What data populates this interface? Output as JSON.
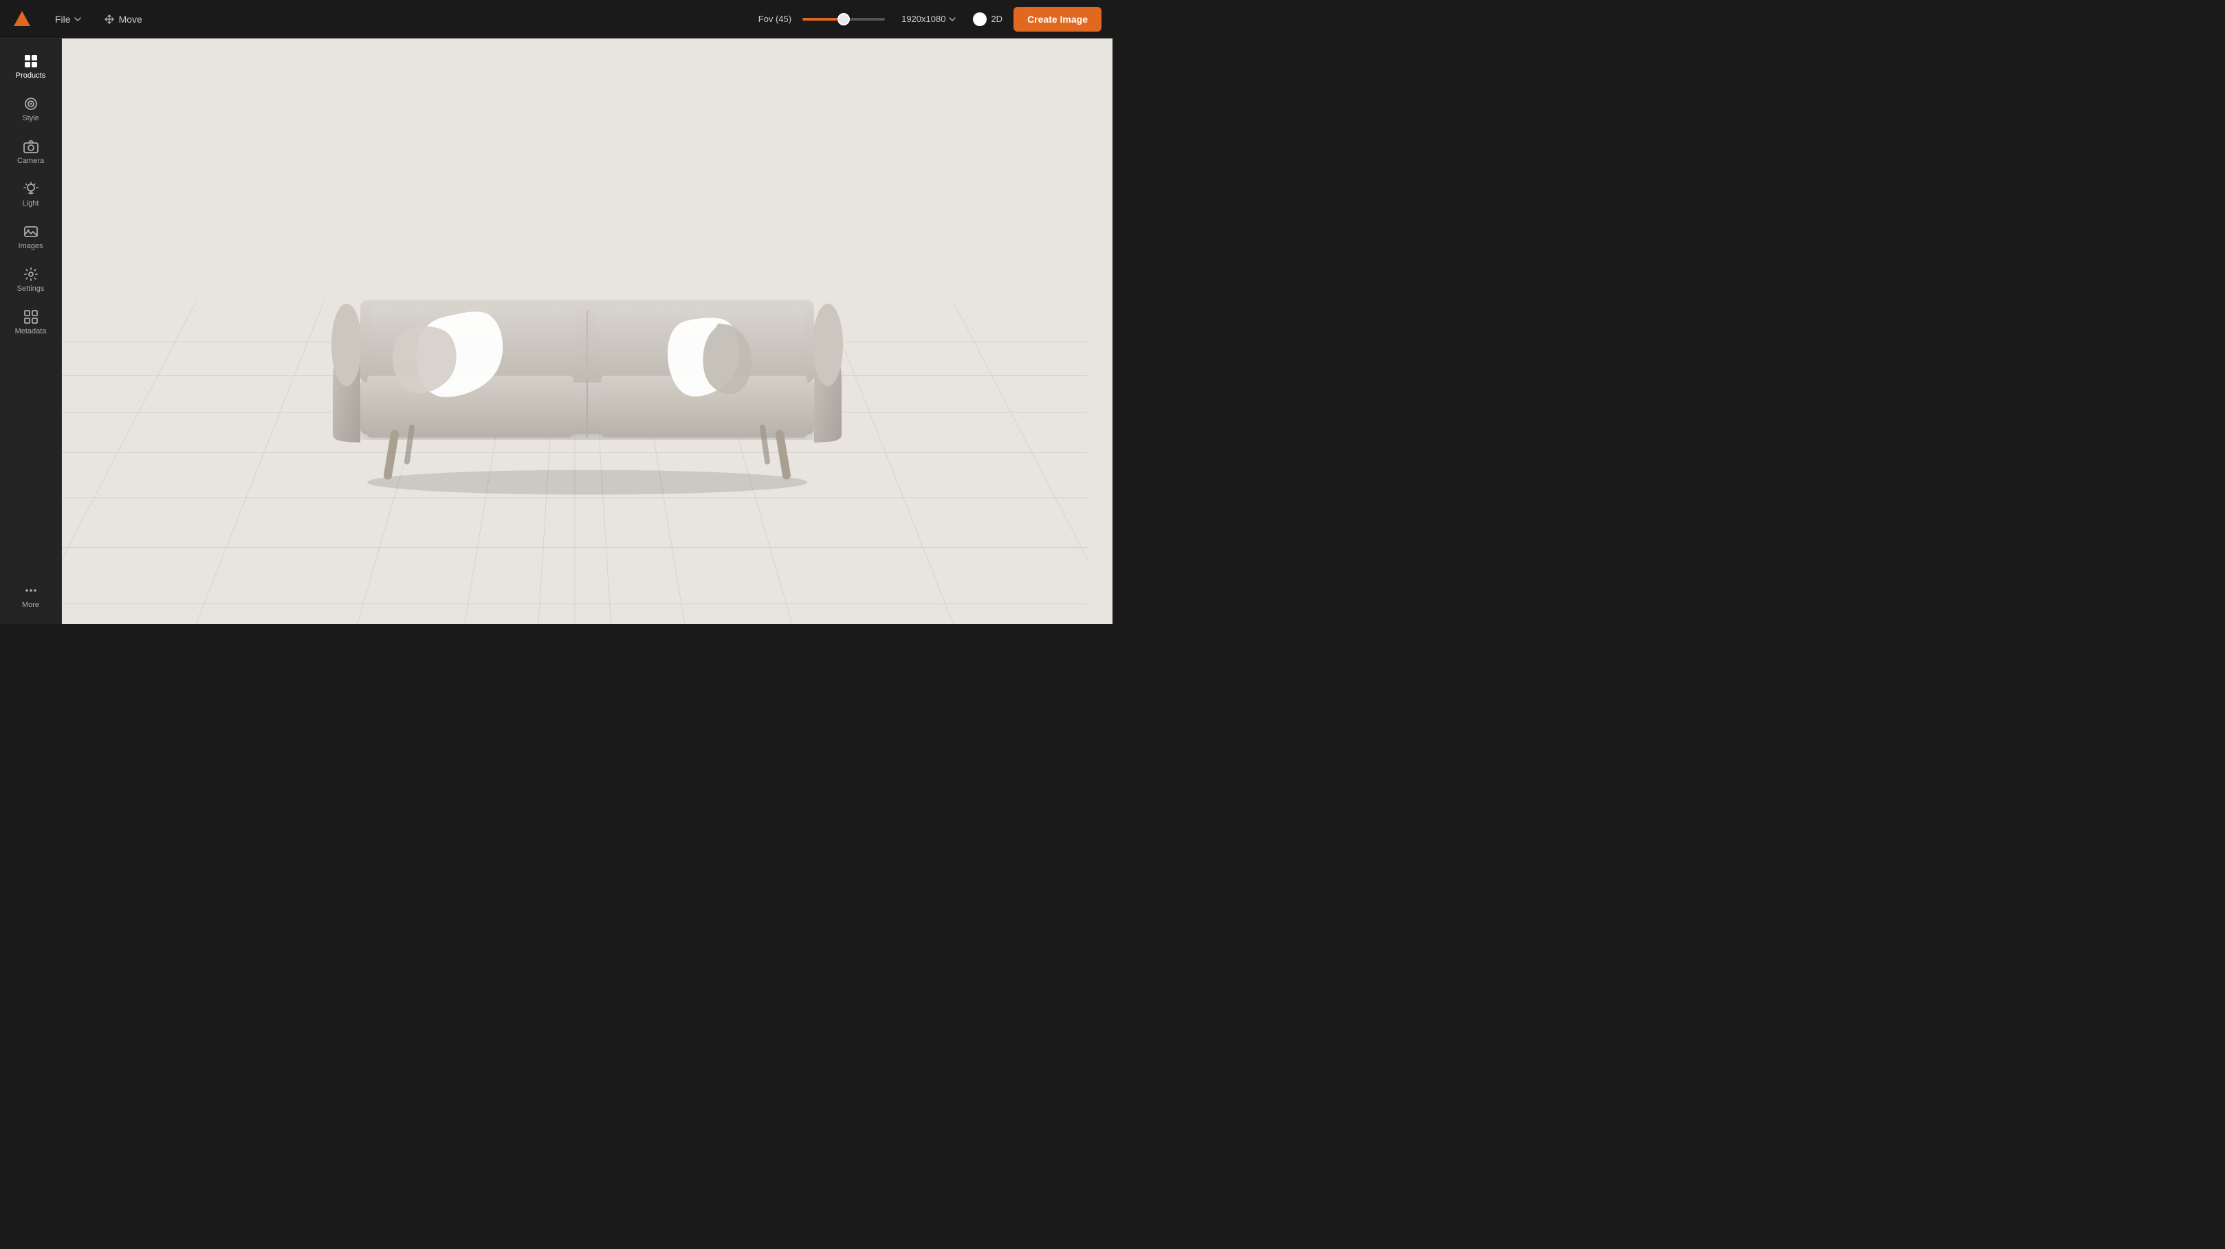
{
  "topbar": {
    "file_label": "File",
    "move_label": "Move",
    "fov_label": "Fov (45)",
    "fov_value": 50,
    "resolution_label": "1920x1080",
    "twod_label": "2D",
    "create_label": "Create Image",
    "accent_color": "#e06820"
  },
  "sidebar": {
    "items": [
      {
        "id": "products",
        "label": "Products",
        "icon": "⊞"
      },
      {
        "id": "style",
        "label": "Style",
        "icon": "◎"
      },
      {
        "id": "camera",
        "label": "Camera",
        "icon": "📷"
      },
      {
        "id": "light",
        "label": "Light",
        "icon": "💡"
      },
      {
        "id": "images",
        "label": "Images",
        "icon": "🖼"
      },
      {
        "id": "settings",
        "label": "Settings",
        "icon": "⚙"
      },
      {
        "id": "metadata",
        "label": "Metadata",
        "icon": "⊟"
      }
    ],
    "more_label": "More"
  }
}
